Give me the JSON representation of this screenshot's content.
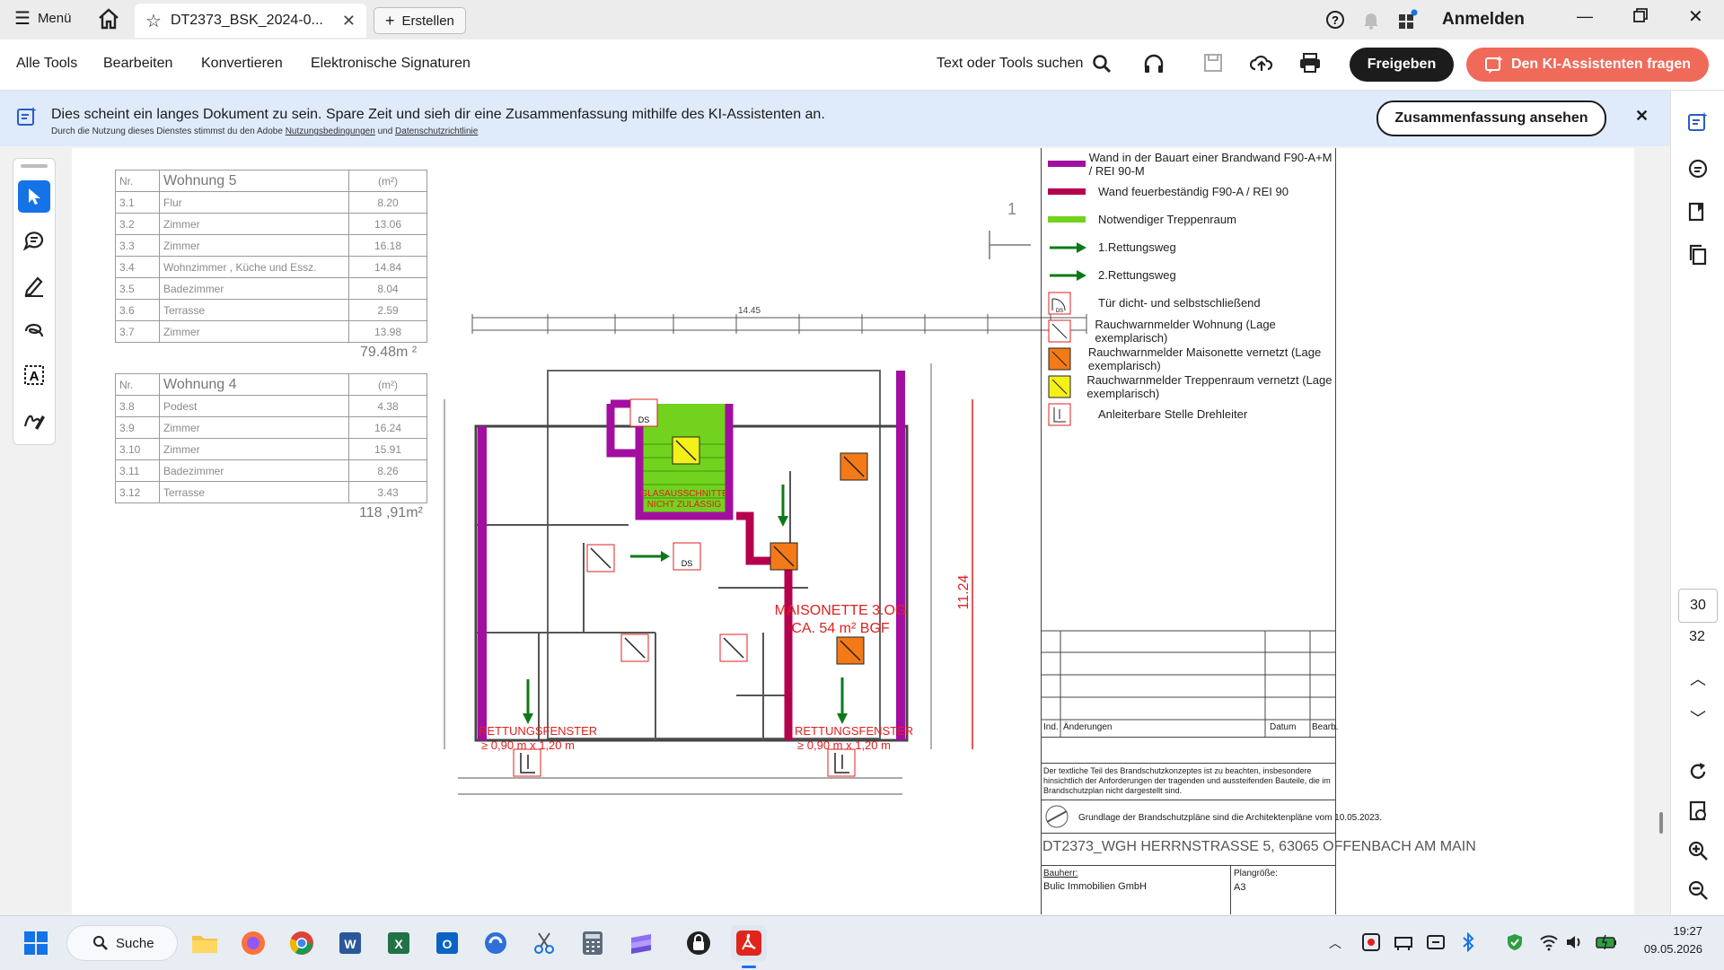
{
  "titlebar": {
    "menu_label": "Menü",
    "doc_tab_title": "DT2373_BSK_2024-0...",
    "create_label": "Erstellen",
    "signin_label": "Anmelden"
  },
  "menubar": {
    "items": [
      "Alle Tools",
      "Bearbeiten",
      "Konvertieren",
      "Elektronische Signaturen"
    ],
    "search_label": "Text oder Tools suchen",
    "share_label": "Freigeben",
    "ai_label": "Den KI-Assistenten fragen"
  },
  "banner": {
    "message": "Dies scheint ein langes Dokument zu sein. Spare Zeit und sieh dir eine Zusammenfassung mithilfe des KI-Assistenten an.",
    "fine_prefix": "Durch die Nutzung dieses Dienstes stimmst du den Adobe",
    "terms_link": "Nutzungsbedingungen",
    "fine_and": "und",
    "privacy_link": "Datenschutzrichtlinie",
    "summary_button": "Zusammenfassung ansehen"
  },
  "page_nav": {
    "current_page": "30",
    "total_pages": "32"
  },
  "drawing": {
    "table5": {
      "header": [
        "Nr.",
        "Wohnung 5",
        "(m²)"
      ],
      "rows": [
        [
          "3.1",
          "Flur",
          "8.20"
        ],
        [
          "3.2",
          "Zimmer",
          "13.06"
        ],
        [
          "3.3",
          "Zimmer",
          "16.18"
        ],
        [
          "3.4",
          "Wohnzimmer , Küche und Essz.",
          "14.84"
        ],
        [
          "3.5",
          "Badezimmer",
          "8.04"
        ],
        [
          "3.6",
          "Terrasse",
          "2.59"
        ],
        [
          "3.7",
          "Zimmer",
          "13.98"
        ]
      ],
      "total": "79.48m ²"
    },
    "table4": {
      "header": [
        "Nr.",
        "Wohnung 4",
        "(m²)"
      ],
      "rows": [
        [
          "3.8",
          "Podest",
          "4.38"
        ],
        [
          "3.9",
          "Zimmer",
          "16.24"
        ],
        [
          "3.10",
          "Zimmer",
          "15.91"
        ],
        [
          "3.11",
          "Badezimmer",
          "8.26"
        ],
        [
          "3.12",
          "Terrasse",
          "3.43"
        ]
      ],
      "total": "118 ,91m²"
    },
    "section_mark": "1",
    "overall_width": "14.45",
    "stair_note": "GLASAUSSCHNITTE NICHT ZULÄSSIG",
    "maisonette_line1": "MAISONETTE 3.OG",
    "maisonette_line2": "CA. 54 m² BGF",
    "height_label": "11.24",
    "rescue_window": "RETTUNGSFENSTER",
    "rescue_window_size": "≥ 0,90 m x 1,20 m",
    "ds_label": "DS"
  },
  "legend": [
    {
      "label": "Wand in der Bauart einer Brandwand F90-A+M / REI 90-M",
      "symbol": "bar",
      "color": "#a20fa0"
    },
    {
      "label": "Wand feuerbeständig F90-A / REI 90",
      "symbol": "bar",
      "color": "#b5004d"
    },
    {
      "label": "Notwendiger Treppenraum",
      "symbol": "bar",
      "color": "#72d21e"
    },
    {
      "label": "1.Rettungsweg",
      "symbol": "arrow",
      "color": "#0c7a18"
    },
    {
      "label": "2.Rettungsweg",
      "symbol": "arrow",
      "color": "#0c7a18"
    },
    {
      "label": "Tür dicht- und selbstschließend",
      "symbol": "door-icon",
      "color": "#e02020"
    },
    {
      "label": "Rauchwarnmelder Wohnung (Lage exemplarisch)",
      "symbol": "detector",
      "color": "#ffffff"
    },
    {
      "label": "Rauchwarnmelder Maisonette vernetzt (Lage exemplarisch)",
      "symbol": "detector",
      "color": "#f47a18"
    },
    {
      "label": "Rauchwarnmelder Treppenraum vernetzt (Lage exemplarisch)",
      "symbol": "detector",
      "color": "#f4f019"
    },
    {
      "label": "Anleiterbare Stelle Drehleiter",
      "symbol": "ladder-icon",
      "color": "#e02020"
    }
  ],
  "titleblock": {
    "changes": "Änderungen",
    "date": "Datum",
    "index": "Ind.",
    "editor": "Bearb.",
    "note": "Der textliche Teil des Brandschutzkonzeptes ist zu beachten, insbesondere hinsichtlich der Anforderungen der tragenden und aussteifenden Bauteile, die im Brandschutzplan nicht dargestellt sind.",
    "basis": "Grundlage der Brandschutzpläne sind die Architektenpläne vom 10.05.2023.",
    "project": "DT2373_WGH HERRNSTRASSE 5, 63065 OFFENBACH AM MAIN",
    "client_label": "Bauherr:",
    "client": "Bulic Immobilien GmbH",
    "size_label": "Plangröße:",
    "size": "A3"
  },
  "taskbar": {
    "search_label": "Suche",
    "time": "19:27",
    "date": "09.05.2026"
  },
  "colors": {
    "accent_red": "#f06a5a",
    "share_dark": "#1c1c1c",
    "banner_bg": "#dfeafb",
    "stair_green": "#72d21e",
    "firewall_purple": "#a20fa0",
    "fire_wall_red": "#b5004d"
  }
}
